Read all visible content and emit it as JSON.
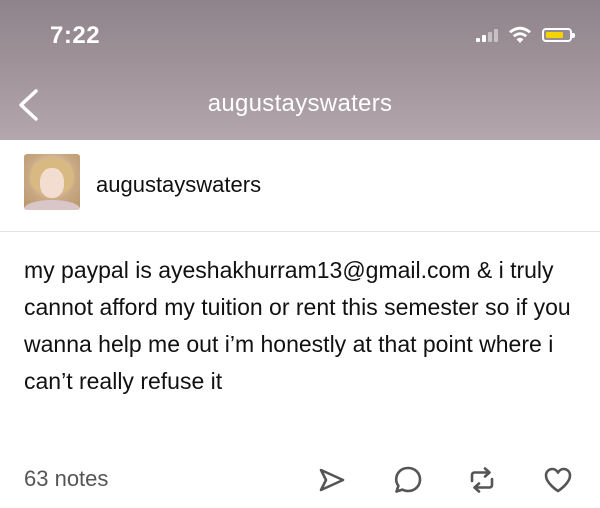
{
  "status_bar": {
    "time": "7:22"
  },
  "nav": {
    "title": "augustayswaters"
  },
  "post": {
    "username": "augustayswaters",
    "body": "my paypal is ayeshakhurram13@gmail.com & i truly cannot afford my tuition or rent this semester so if you wanna help me out i’m honestly at that point where i can’t really refuse it"
  },
  "footer": {
    "notes": "63 notes"
  },
  "icons": {
    "back": "back-arrow-icon",
    "signal": "cellular-signal-icon",
    "wifi": "wifi-icon",
    "battery": "battery-icon",
    "share": "share-icon",
    "reply": "reply-icon",
    "reblog": "reblog-icon",
    "like": "heart-icon"
  },
  "colors": {
    "header_top": "#8f838b",
    "header_bottom": "#b3a6ad",
    "battery_fill": "#f5d300",
    "text": "#111111",
    "muted_text": "#555555"
  }
}
